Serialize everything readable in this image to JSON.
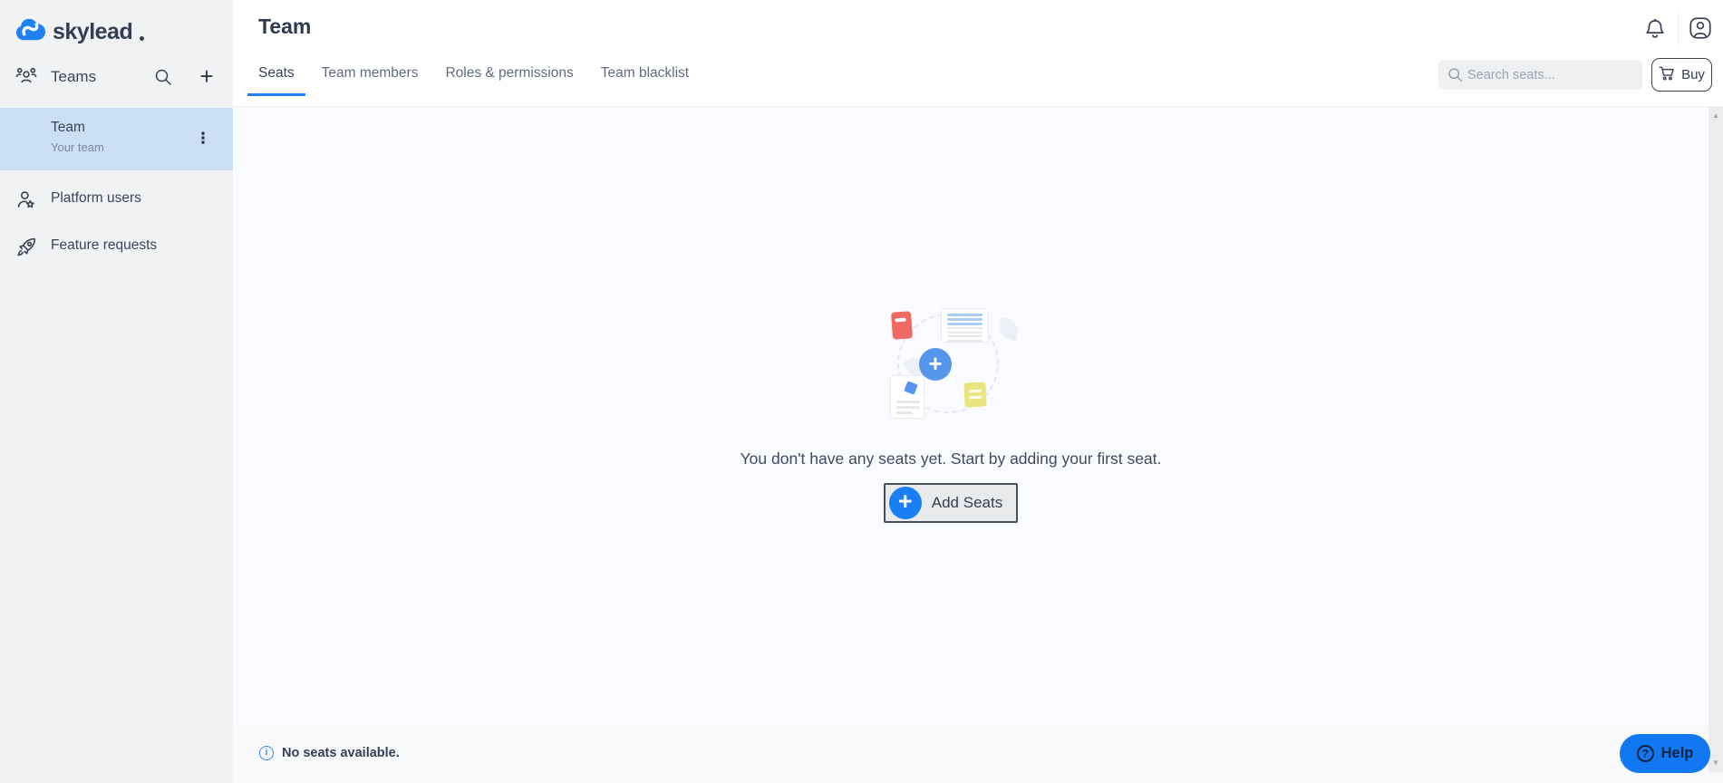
{
  "colors": {
    "accent_blue": "#1a7ff2",
    "logo_blue": "#2180f3",
    "sidebar_bg": "#f1f2f4",
    "selected_team_bg": "#cbe0f5",
    "content_bg": "#fafbff",
    "help_bg": "#1278f2",
    "text_dark": "#39445c"
  },
  "brand": {
    "name": "skylead"
  },
  "sidebar": {
    "header": {
      "label": "Teams"
    },
    "selected_team": {
      "name": "Team",
      "subtitle": "Your team"
    },
    "items": [
      {
        "label": "Platform users",
        "icon": "user-star-icon"
      },
      {
        "label": "Feature requests",
        "icon": "rocket-icon"
      }
    ]
  },
  "header": {
    "title": "Team"
  },
  "tabs": [
    {
      "label": "Seats",
      "active": true
    },
    {
      "label": "Team members",
      "active": false
    },
    {
      "label": "Roles & permissions",
      "active": false
    },
    {
      "label": "Team blacklist",
      "active": false
    }
  ],
  "toolbar": {
    "search_placeholder": "Search seats...",
    "search_value": "",
    "buy_label": "Buy"
  },
  "empty_state": {
    "message": "You don't have any seats yet. Start by adding your first seat.",
    "add_button_label": "Add Seats",
    "plus_glyph": "+"
  },
  "footer": {
    "status": "No seats available."
  },
  "help": {
    "label": "Help"
  },
  "icons": {
    "plus": "+",
    "kebab": "⋮",
    "info": "i",
    "question": "?",
    "scroll_up": "▲",
    "scroll_down": "▼"
  }
}
